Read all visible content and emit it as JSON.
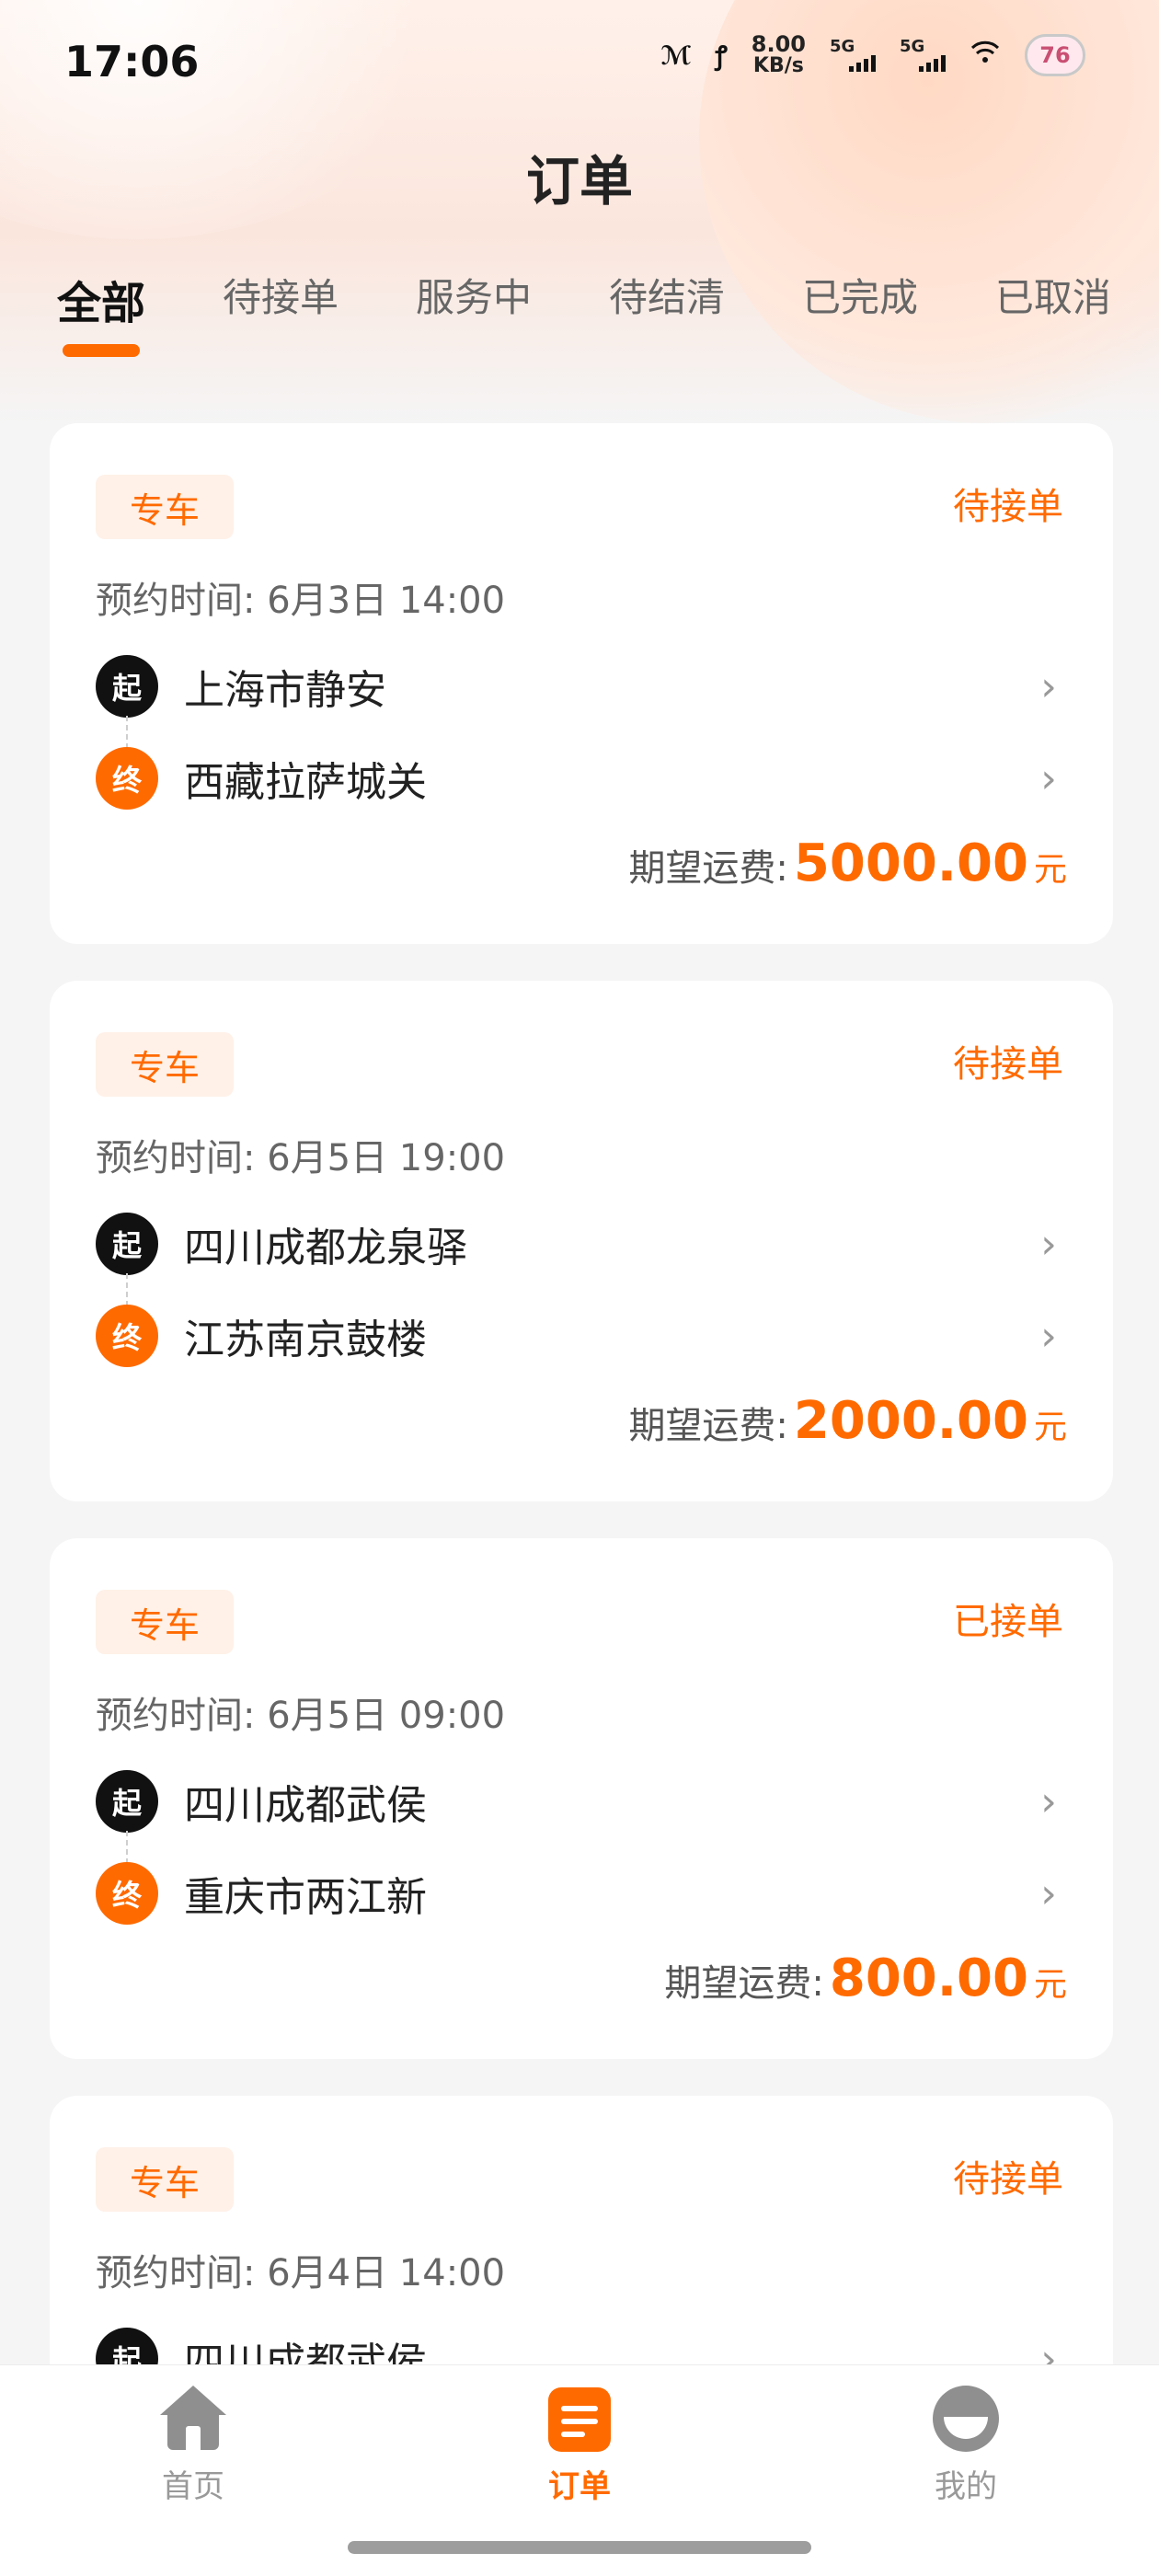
{
  "status_bar": {
    "time": "17:06",
    "net_speed_value": "8.00",
    "net_speed_unit": "KB/s",
    "signal1_label": "5G",
    "signal2_label": "5G",
    "battery": "76"
  },
  "header": {
    "title": "订单"
  },
  "tabs": [
    {
      "label": "全部",
      "active": true
    },
    {
      "label": "待接单"
    },
    {
      "label": "服务中"
    },
    {
      "label": "待结清"
    },
    {
      "label": "已完成"
    },
    {
      "label": "已取消"
    }
  ],
  "orders": [
    {
      "tag": "专车",
      "status": "待接单",
      "time": "预约时间: 6月3日 14:00",
      "start_badge": "起",
      "start": "上海市静安",
      "end_badge": "终",
      "end": "西藏拉萨城关",
      "fee_label": "期望运费:",
      "fee_amount": "5000.00",
      "fee_unit": "元"
    },
    {
      "tag": "专车",
      "status": "待接单",
      "time": "预约时间: 6月5日 19:00",
      "start_badge": "起",
      "start": "四川成都龙泉驿",
      "end_badge": "终",
      "end": "江苏南京鼓楼",
      "fee_label": "期望运费:",
      "fee_amount": "2000.00",
      "fee_unit": "元"
    },
    {
      "tag": "专车",
      "status": "已接单",
      "time": "预约时间: 6月5日 09:00",
      "start_badge": "起",
      "start": "四川成都武侯",
      "end_badge": "终",
      "end": "重庆市两江新",
      "fee_label": "期望运费:",
      "fee_amount": "800.00",
      "fee_unit": "元"
    },
    {
      "tag": "专车",
      "status": "待接单",
      "time": "预约时间: 6月4日 14:00",
      "start_badge": "起",
      "start": "四川成都武侯",
      "end_badge": "终",
      "end": "",
      "fee_label": "",
      "fee_amount": "",
      "fee_unit": ""
    }
  ],
  "bottom_nav": {
    "home": "首页",
    "orders": "订单",
    "me": "我的"
  },
  "colors": {
    "accent": "#ff6a00",
    "tag_bg": "#fff1e8"
  }
}
